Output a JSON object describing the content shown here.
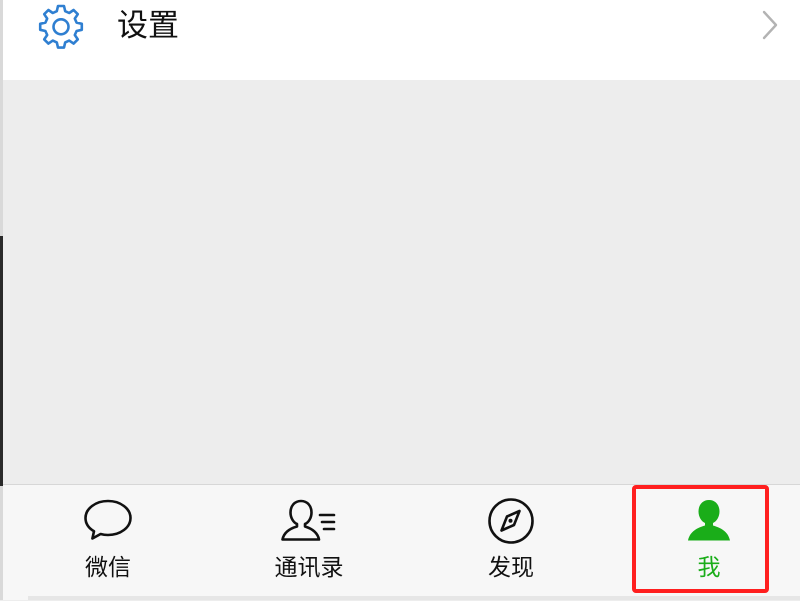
{
  "settings_row": {
    "label": "设置",
    "icon": "gear-icon",
    "chevron": "chevron-right-icon"
  },
  "tab_bar": {
    "tabs": [
      {
        "label": "微信",
        "icon": "chat-bubble-icon",
        "active": false
      },
      {
        "label": "通讯录",
        "icon": "contacts-icon",
        "active": false
      },
      {
        "label": "发现",
        "icon": "compass-icon",
        "active": false
      },
      {
        "label": "我",
        "icon": "person-icon",
        "active": true
      }
    ]
  },
  "colors": {
    "active_green": "#1aad19",
    "settings_blue": "#2f7fd1",
    "highlight_red": "#ff1f1f"
  }
}
